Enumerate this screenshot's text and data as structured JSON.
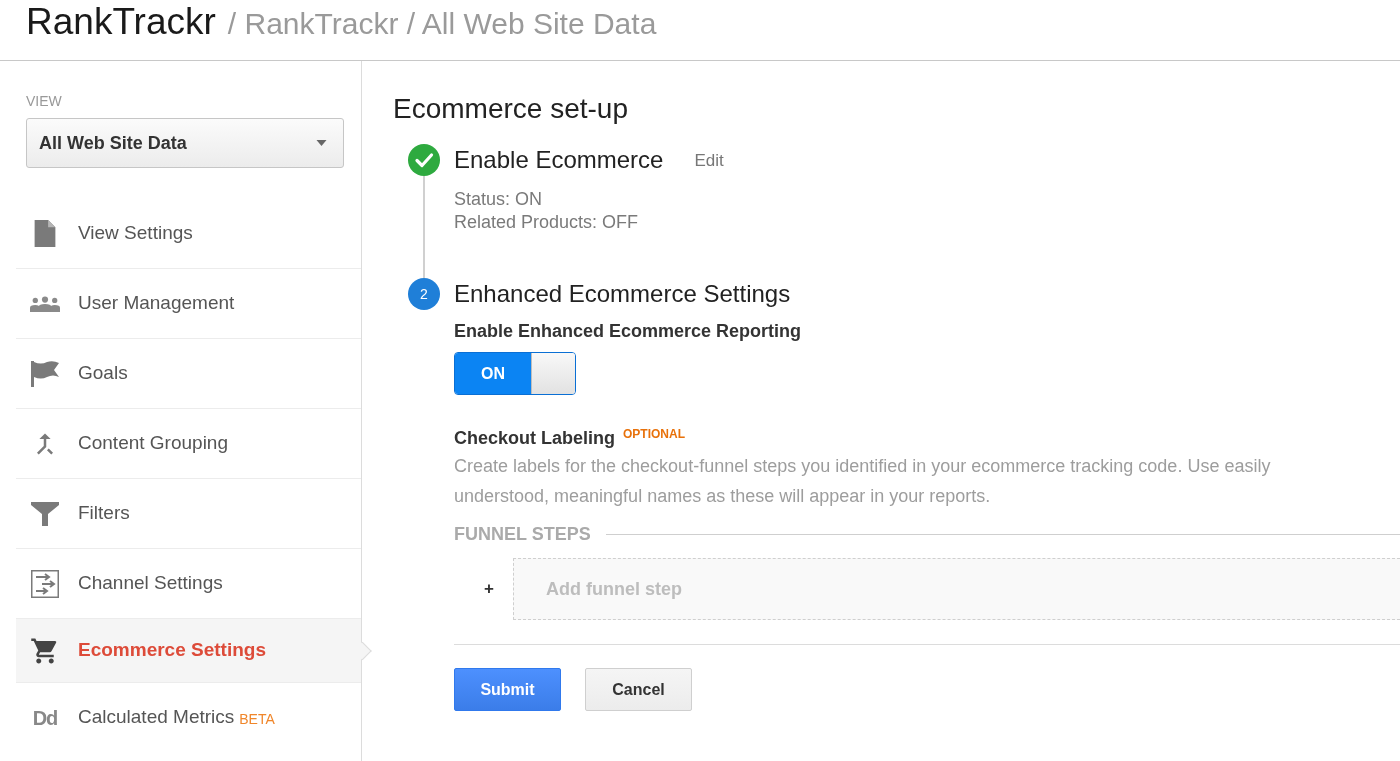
{
  "header": {
    "title": "RankTrackr",
    "path": "/ RankTrackr / All Web Site Data"
  },
  "sidebar": {
    "view_label": "VIEW",
    "view_select": {
      "value": "All Web Site Data"
    },
    "items": [
      {
        "label": "View Settings",
        "selected": false
      },
      {
        "label": "User Management",
        "selected": false
      },
      {
        "label": "Goals",
        "selected": false
      },
      {
        "label": "Content Grouping",
        "selected": false
      },
      {
        "label": "Filters",
        "selected": false
      },
      {
        "label": "Channel Settings",
        "selected": false
      },
      {
        "label": "Ecommerce Settings",
        "selected": true
      },
      {
        "label": "Calculated Metrics",
        "selected": false,
        "glyph": "Dd",
        "badge": "BETA"
      }
    ]
  },
  "main": {
    "title": "Ecommerce set-up",
    "steps": [
      {
        "completed": true,
        "title": "Enable Ecommerce",
        "action": "Edit",
        "details": [
          "Status: ON",
          "Related Products: OFF"
        ]
      },
      {
        "completed": false,
        "number": "2",
        "title": "Enhanced Ecommerce Settings",
        "reporting": {
          "label": "Enable Enhanced Ecommerce Reporting",
          "on": true,
          "state_text": "ON"
        },
        "checkout": {
          "title": "Checkout Labeling",
          "badge": "OPTIONAL",
          "description": "Create labels for the checkout-funnel steps you identified in your ecommerce tracking code. Use easily understood, meaningful names as these will appear in your reports.",
          "funnel_label": "FUNNEL STEPS",
          "add_symbol": "+",
          "add_label": "Add funnel step"
        }
      }
    ],
    "buttons": [
      {
        "label": "Submit",
        "kind": "primary"
      },
      {
        "label": "Cancel",
        "kind": "secondary"
      }
    ]
  }
}
